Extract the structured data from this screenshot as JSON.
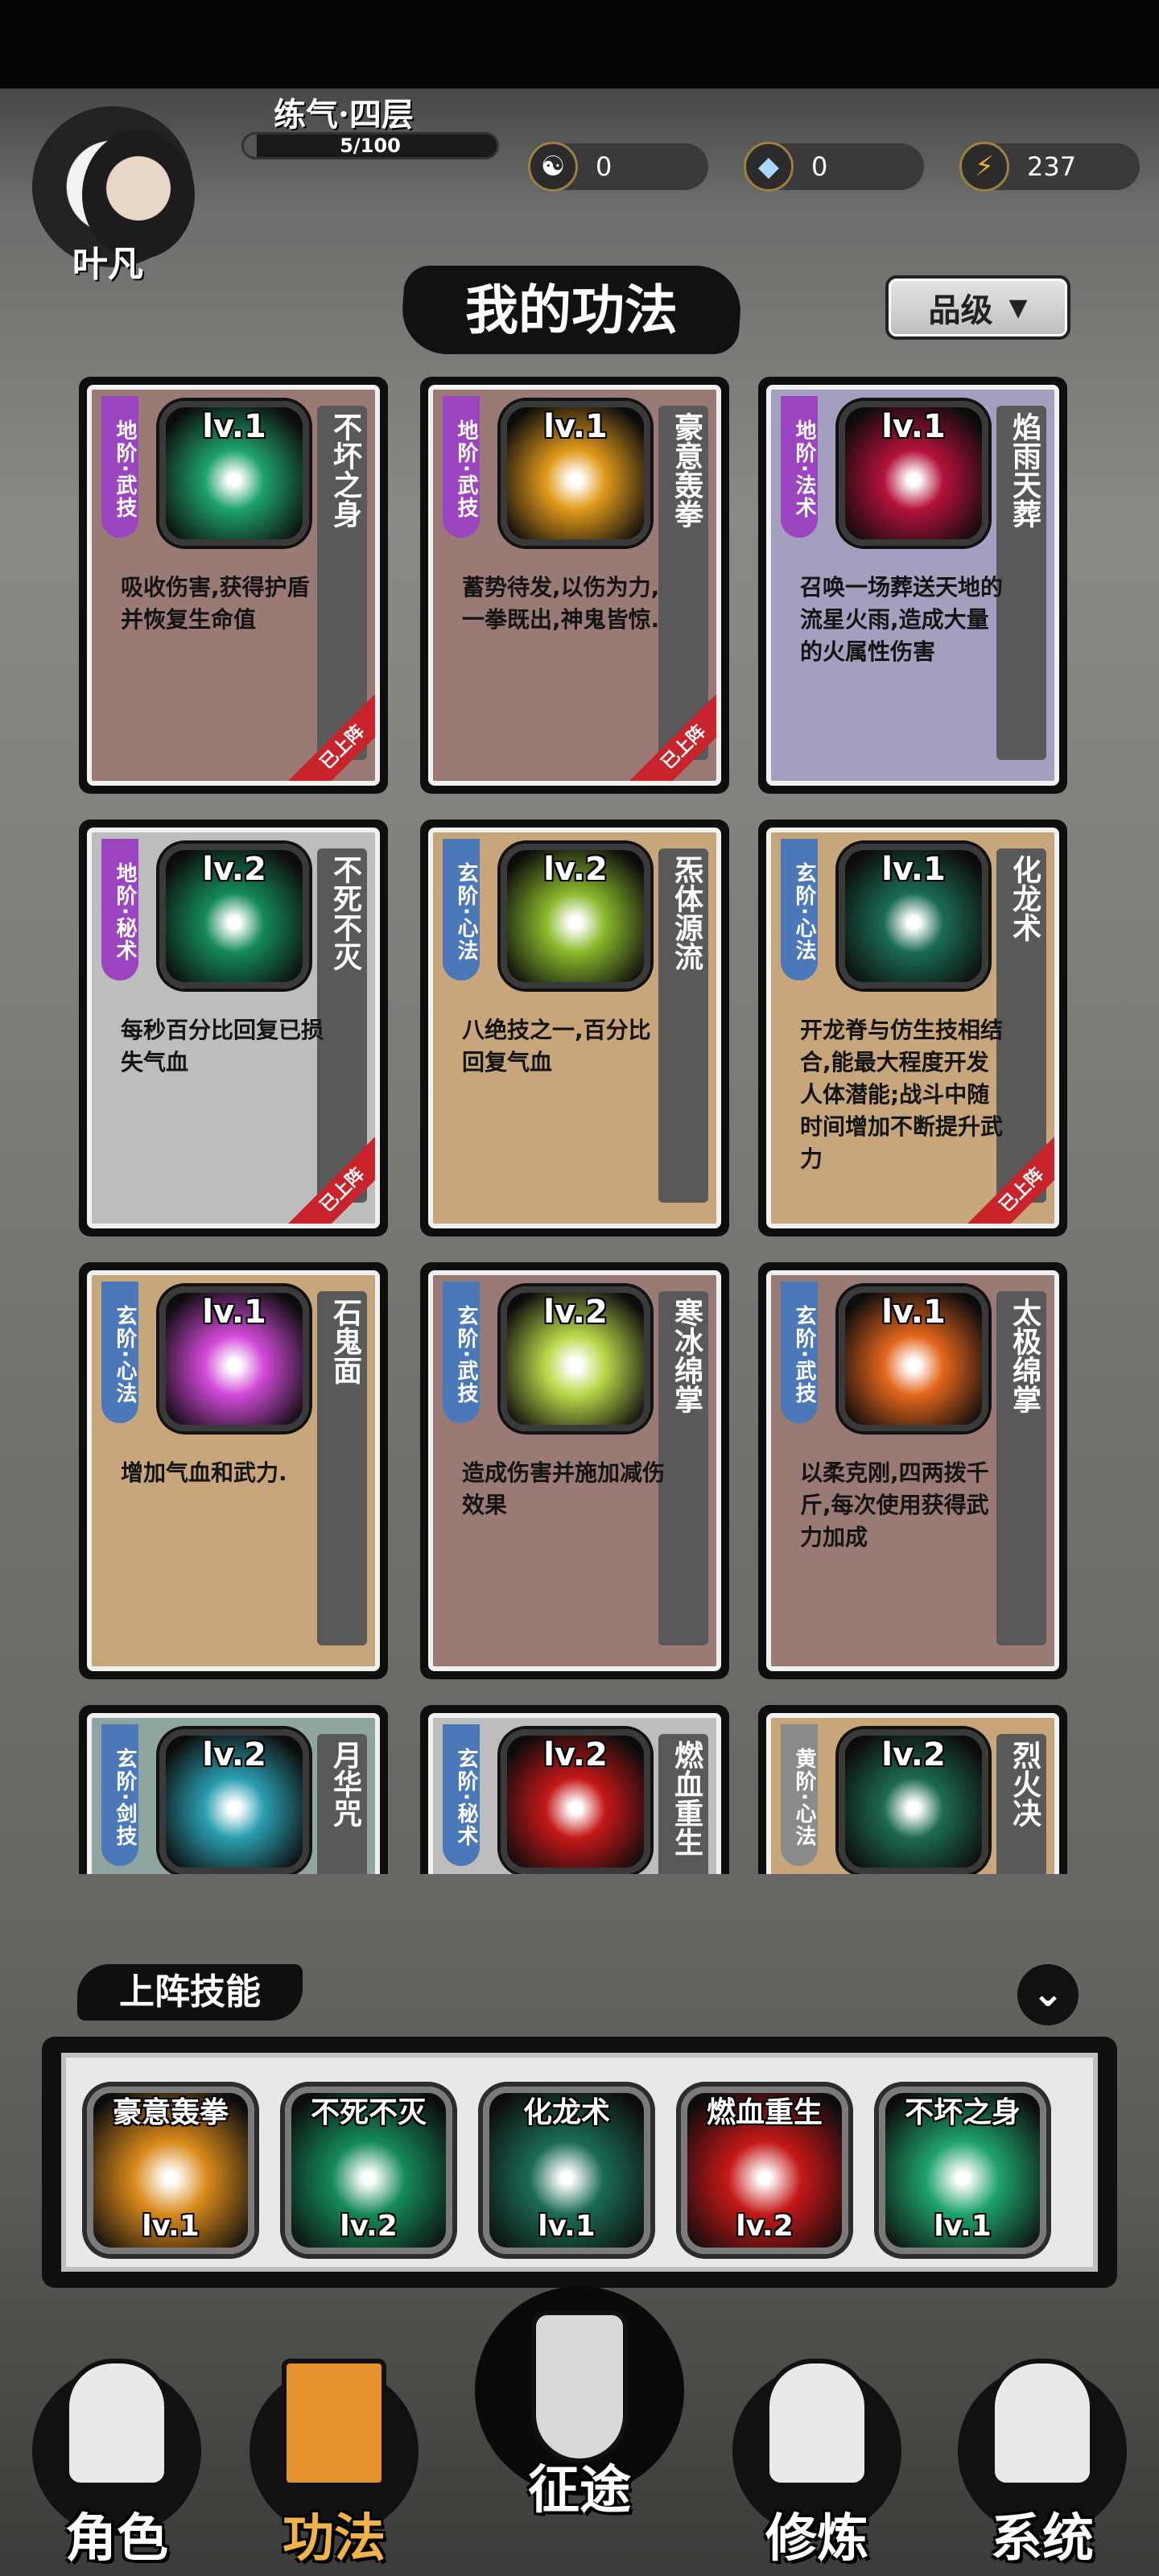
{
  "player": {
    "name": "叶凡",
    "realm": "练气·四层",
    "exp_text": "5/100",
    "exp_fraction": 0.05
  },
  "resources": [
    {
      "icon": "yin-yang-icon",
      "value": "0"
    },
    {
      "icon": "crystal-icon",
      "value": "0"
    },
    {
      "icon": "lightning-icon",
      "value": "237"
    }
  ],
  "page": {
    "title": "我的功法",
    "sort_label": "品级"
  },
  "skills": [
    {
      "grade": "地阶·武技",
      "grade_color": "#9b45c0",
      "level": "lv.1",
      "name": "不坏之身",
      "desc": "吸收伤害,获得护盾并恢复生命值",
      "bg": "#9a7a74",
      "equipped": "已上阵",
      "art": "#1ea26a"
    },
    {
      "grade": "地阶·武技",
      "grade_color": "#9b45c0",
      "level": "lv.1",
      "name": "豪意轰拳",
      "desc": "蓄势待发,以伤为力,一拳既出,神鬼皆惊.",
      "bg": "#9a7a74",
      "equipped": "已上阵",
      "art": "#e09a1a"
    },
    {
      "grade": "地阶·法术",
      "grade_color": "#9b45c0",
      "level": "lv.1",
      "name": "焰雨天葬",
      "desc": "召唤一场葬送天地的流星火雨,造成大量的火属性伤害",
      "bg": "#a39fbe",
      "equipped": "",
      "art": "#b3123a"
    },
    {
      "grade": "地阶·秘术",
      "grade_color": "#9b45c0",
      "level": "lv.2",
      "name": "不死不灭",
      "desc": "每秒百分比回复已损失气血",
      "bg": "#bdbdbd",
      "equipped": "已上阵",
      "art": "#148a58"
    },
    {
      "grade": "玄阶·心法",
      "grade_color": "#4a78b8",
      "level": "lv.2",
      "name": "炁体源流",
      "desc": "八绝技之一,百分比回复气血",
      "bg": "#c7a67b",
      "equipped": "",
      "art": "#8ab82a"
    },
    {
      "grade": "玄阶·心法",
      "grade_color": "#4a78b8",
      "level": "lv.1",
      "name": "化龙术",
      "desc": "开龙脊与仿生技相结合,能最大程度开发人体潜能;战斗中随时间增加不断提升武力",
      "bg": "#c7a67b",
      "equipped": "已上阵",
      "art": "#1b6b55"
    },
    {
      "grade": "玄阶·心法",
      "grade_color": "#4a78b8",
      "level": "lv.1",
      "name": "石鬼面",
      "desc": "增加气血和武力.",
      "bg": "#c7a67b",
      "equipped": "",
      "art": "#d24ad8"
    },
    {
      "grade": "玄阶·武技",
      "grade_color": "#4a78b8",
      "level": "lv.2",
      "name": "寒冰绵掌",
      "desc": "造成伤害并施加减伤效果",
      "bg": "#9a7a74",
      "equipped": "",
      "art": "#b9d848"
    },
    {
      "grade": "玄阶·武技",
      "grade_color": "#4a78b8",
      "level": "lv.1",
      "name": "太极绵掌",
      "desc": "以柔克刚,四两拨千斤,每次使用获得武力加成",
      "bg": "#9a7a74",
      "equipped": "",
      "art": "#e2661c"
    },
    {
      "grade": "玄阶·剑技",
      "grade_color": "#4a78b8",
      "level": "lv.2",
      "name": "月华咒",
      "desc": "",
      "bg": "#8ea5a0",
      "equipped": "",
      "art": "#2a9fb0"
    },
    {
      "grade": "玄阶·秘术",
      "grade_color": "#4a78b8",
      "level": "lv.2",
      "name": "燃血重生",
      "desc": "",
      "bg": "#bdbdbd",
      "equipped": "",
      "art": "#c41818"
    },
    {
      "grade": "黄阶·心法",
      "grade_color": "#8a8a8a",
      "level": "lv.2",
      "name": "烈火决",
      "desc": "",
      "bg": "#c7a67b",
      "equipped": "",
      "art": "#1d6b4f"
    }
  ],
  "lineup": {
    "title": "上阵技能",
    "expand_icon": "chevron-down-icon",
    "slots": [
      {
        "name": "豪意轰拳",
        "level": "lv.1",
        "art": "#d98a1a"
      },
      {
        "name": "不死不灭",
        "level": "lv.2",
        "art": "#148a58"
      },
      {
        "name": "化龙术",
        "level": "lv.1",
        "art": "#1b6b55"
      },
      {
        "name": "燃血重生",
        "level": "lv.2",
        "art": "#c41818"
      },
      {
        "name": "不坏之身",
        "level": "lv.1",
        "art": "#1ea26a"
      }
    ]
  },
  "nav": [
    {
      "label": "角色",
      "icon": "hooded-figure-icon",
      "active": false
    },
    {
      "label": "功法",
      "icon": "books-icon",
      "active": true
    },
    {
      "label": "征途",
      "icon": "sword-emblem-icon",
      "active": false
    },
    {
      "label": "修炼",
      "icon": "meditation-icon",
      "active": false
    },
    {
      "label": "系统",
      "icon": "panda-icon",
      "active": false
    }
  ]
}
